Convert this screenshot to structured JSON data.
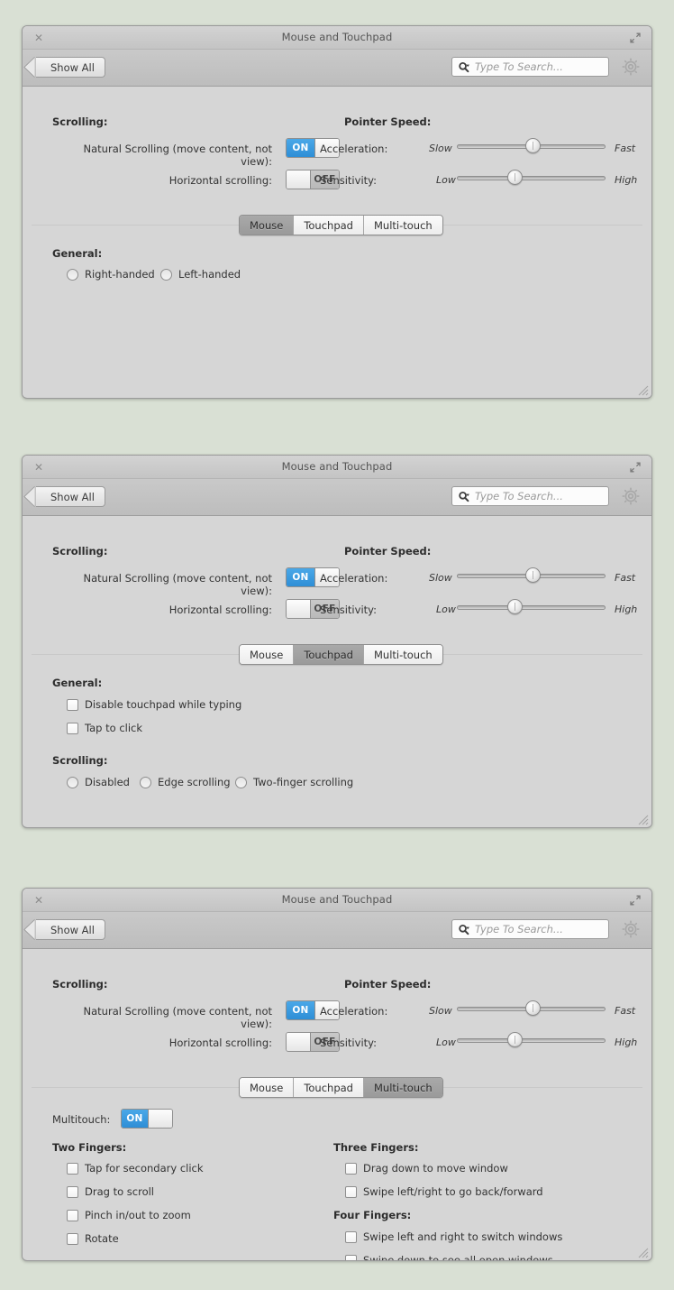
{
  "window": {
    "title": "Mouse and Touchpad",
    "close_icon": "close-icon",
    "expand_icon": "expand-icon",
    "resize_grip": "resize-grip"
  },
  "toolbar": {
    "show_all_label": "Show All",
    "search_placeholder": "Type To Search...",
    "search_value": "",
    "search_icon": "search-icon",
    "gear_icon": "gear-icon",
    "back_arrow_icon": "back-arrow-icon"
  },
  "scrolling": {
    "heading": "Scrolling:",
    "natural_label": "Natural Scrolling  (move content, not view):",
    "natural_state": "ON",
    "horizontal_label": "Horizontal scrolling:",
    "horizontal_state": "OFF"
  },
  "pointer_speed": {
    "heading": "Pointer Speed:",
    "acceleration_label": "Acceleration:",
    "acceleration_min": "Slow",
    "acceleration_max": "Fast",
    "acceleration_value": 51,
    "sensitivity_label": "Sensitivity:",
    "sensitivity_min": "Low",
    "sensitivity_max": "High",
    "sensitivity_value": 39
  },
  "tabs": {
    "mouse": "Mouse",
    "touchpad": "Touchpad",
    "multitouch": "Multi-touch",
    "selected_win1": "Mouse",
    "selected_win2": "Touchpad",
    "selected_win3": "Multi-touch"
  },
  "mouse_pane": {
    "general_heading": "General:",
    "options": [
      {
        "label": "Right-handed",
        "checked": false
      },
      {
        "label": "Left-handed",
        "checked": false
      }
    ]
  },
  "touchpad_pane": {
    "general_heading": "General:",
    "general_options": [
      {
        "label": "Disable touchpad while typing",
        "checked": false
      },
      {
        "label": "Tap to click",
        "checked": false
      }
    ],
    "scrolling_heading": "Scrolling:",
    "scrolling_options": [
      {
        "label": "Disabled",
        "checked": false
      },
      {
        "label": "Edge scrolling",
        "checked": false
      },
      {
        "label": "Two-finger scrolling",
        "checked": false
      }
    ]
  },
  "multitouch_pane": {
    "multitouch_label": "Multitouch:",
    "multitouch_state": "ON",
    "two_fingers_heading": "Two Fingers:",
    "two_fingers_options": [
      {
        "label": "Tap for secondary click",
        "checked": false
      },
      {
        "label": "Drag to scroll",
        "checked": false
      },
      {
        "label": "Pinch in/out to zoom",
        "checked": false
      },
      {
        "label": "Rotate",
        "checked": false
      }
    ],
    "three_fingers_heading": "Three Fingers:",
    "three_fingers_options": [
      {
        "label": "Drag down to move window",
        "checked": false
      },
      {
        "label": "Swipe left/right to go back/forward",
        "checked": false
      }
    ],
    "four_fingers_heading": "Four Fingers:",
    "four_fingers_options": [
      {
        "label": "Swipe left and right to switch windows",
        "checked": false
      },
      {
        "label": "Swipe down to see all open windows",
        "checked": false
      }
    ]
  },
  "colors": {
    "desktop": "#d9e0d4",
    "window_body": "#d6d6d6",
    "toggle_on_blue": "#3a9adf",
    "tab_selected": "#a0a0a0"
  }
}
